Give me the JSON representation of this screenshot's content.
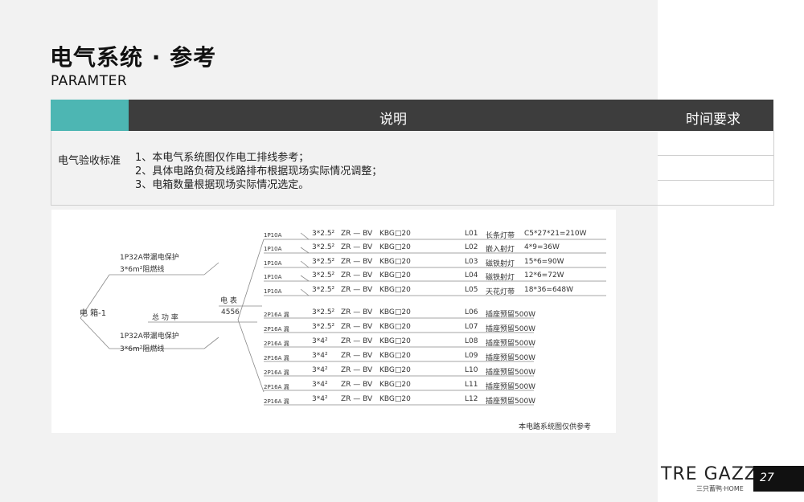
{
  "header": {
    "title": "电气系统 · 参考",
    "subtitle": "PARAMTER"
  },
  "table": {
    "col_explain": "说明",
    "col_time": "时间要求",
    "row_label": "电气验收标准",
    "notes": [
      "1、本电气系统图仅作电工排线参考；",
      "2、具体电路负荷及线路排布根据现场实际情况调整；",
      "3、电箱数量根据现场实际情况选定。"
    ]
  },
  "diagram": {
    "box_label": "电 箱-1",
    "branch_top": [
      "1P32A带漏电保护",
      "3*6m²阻燃线"
    ],
    "branch_bottom": [
      "1P32A带漏电保护",
      "3*6m²阻燃线"
    ],
    "total_power_label": "总 功 率",
    "total_power_value": "4556",
    "meter_label": "电 表",
    "circuits": [
      {
        "breaker": "1P10A",
        "wire": "3*2.5²",
        "type": "ZR — BV",
        "pipe": "KBG□20",
        "code": "L01",
        "name": "长条灯带",
        "power": "C5*27*21=210W"
      },
      {
        "breaker": "1P10A",
        "wire": "3*2.5²",
        "type": "ZR — BV",
        "pipe": "KBG□20",
        "code": "L02",
        "name": "嵌入射灯",
        "power": "4*9=36W"
      },
      {
        "breaker": "1P10A",
        "wire": "3*2.5²",
        "type": "ZR — BV",
        "pipe": "KBG□20",
        "code": "L03",
        "name": "磁铁射灯",
        "power": "15*6=90W"
      },
      {
        "breaker": "1P10A",
        "wire": "3*2.5²",
        "type": "ZR — BV",
        "pipe": "KBG□20",
        "code": "L04",
        "name": "磁铁射灯",
        "power": "12*6=72W"
      },
      {
        "breaker": "1P10A",
        "wire": "3*2.5²",
        "type": "ZR — BV",
        "pipe": "KBG□20",
        "code": "L05",
        "name": "天花灯带",
        "power": "18*36=648W"
      },
      {
        "breaker": "2P16A 漏",
        "wire": "3*2.5²",
        "type": "ZR — BV",
        "pipe": "KBG□20",
        "code": "L06",
        "name": "插座预留500W",
        "power": ""
      },
      {
        "breaker": "2P16A 漏",
        "wire": "3*2.5²",
        "type": "ZR — BV",
        "pipe": "KBG□20",
        "code": "L07",
        "name": "插座预留500W",
        "power": ""
      },
      {
        "breaker": "2P16A 漏",
        "wire": "3*4²",
        "type": "ZR — BV",
        "pipe": "KBG□20",
        "code": "L08",
        "name": "插座预留500W",
        "power": ""
      },
      {
        "breaker": "2P16A 漏",
        "wire": "3*4²",
        "type": "ZR — BV",
        "pipe": "KBG□20",
        "code": "L09",
        "name": "插座预留500W",
        "power": ""
      },
      {
        "breaker": "2P16A 漏",
        "wire": "3*4²",
        "type": "ZR — BV",
        "pipe": "KBG□20",
        "code": "L10",
        "name": "插座预留500W",
        "power": ""
      },
      {
        "breaker": "2P16A 漏",
        "wire": "3*4²",
        "type": "ZR — BV",
        "pipe": "KBG□20",
        "code": "L11",
        "name": "插座预留500W",
        "power": ""
      },
      {
        "breaker": "2P16A 漏",
        "wire": "3*4²",
        "type": "ZR — BV",
        "pipe": "KBG□20",
        "code": "L12",
        "name": "插座预留500W",
        "power": ""
      }
    ],
    "footnote": "本电路系统图仅供参考"
  },
  "brand": {
    "logo_a": "TRE GAZZE",
    "logo_sub": "三只蓄鸭·HOME",
    "page_number": "27"
  },
  "colors": {
    "teal": "#4db6b3",
    "dark": "#3d3d3d",
    "background": "#f2f2f2"
  }
}
